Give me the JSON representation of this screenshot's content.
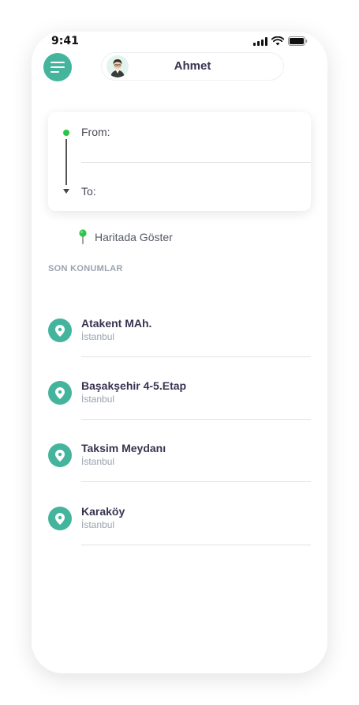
{
  "status_bar": {
    "time": "9:41"
  },
  "header": {
    "menu_icon": "hamburger-menu-icon",
    "user_name": "Ahmet",
    "avatar_icon": "user-avatar"
  },
  "route": {
    "from_label": "From:",
    "to_label": "To:"
  },
  "map_link": {
    "icon": "map-pin-icon",
    "label": "Haritada Göster"
  },
  "recent": {
    "title": "SON KONUMLAR",
    "items": [
      {
        "name": "Atakent MAh.",
        "city": "İstanbul"
      },
      {
        "name": "Başakşehir 4-5.Etap",
        "city": "İstanbul"
      },
      {
        "name": "Taksim Meydanı",
        "city": "İstanbul"
      },
      {
        "name": "Karaköy",
        "city": "İstanbul"
      }
    ]
  },
  "colors": {
    "accent": "#44b59c",
    "from_dot": "#2ec44a",
    "text_dark": "#3a3350",
    "text_muted": "#9aa3ae"
  }
}
